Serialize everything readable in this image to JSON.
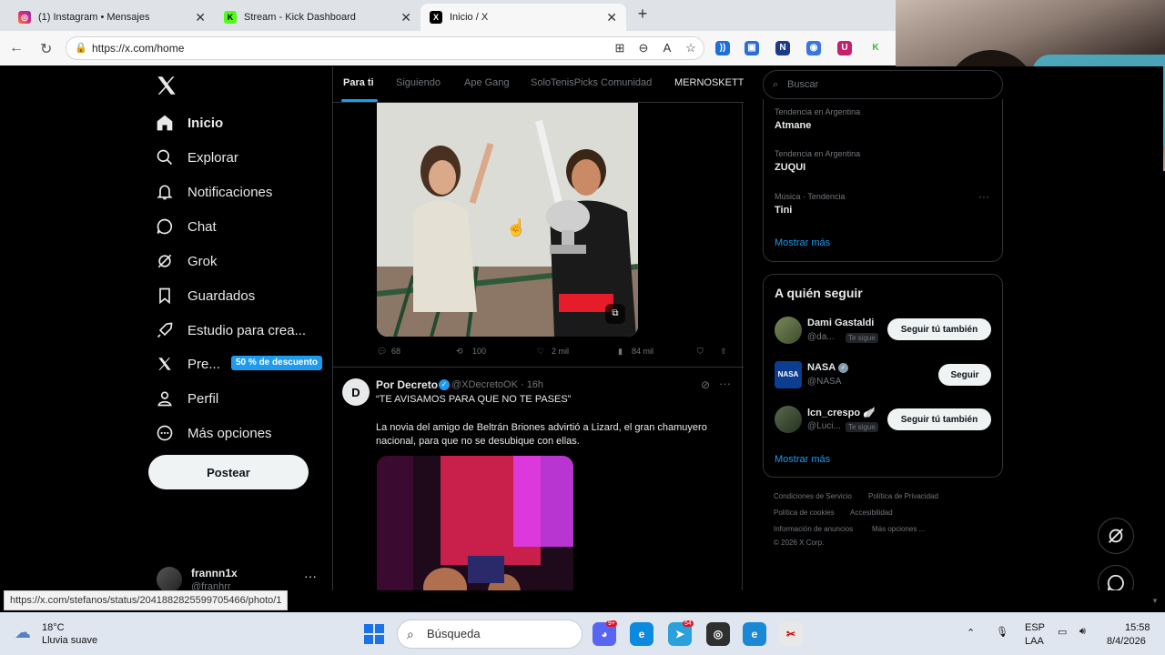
{
  "browser": {
    "tabs": [
      {
        "title": "(1) Instagram • Mensajes",
        "icon": "instagram-icon",
        "active": false
      },
      {
        "title": "Stream - Kick Dashboard",
        "icon": "kick-icon",
        "active": false
      },
      {
        "title": "Inicio / X",
        "icon": "x-icon",
        "active": true
      }
    ],
    "url": "https://x.com/home",
    "status_url": "https://x.com/stefanos/status/2041882825599705466/photo/1"
  },
  "nav": {
    "items": [
      {
        "label": "Inicio",
        "icon": "home-icon"
      },
      {
        "label": "Explorar",
        "icon": "search-icon"
      },
      {
        "label": "Notificaciones",
        "icon": "bell-icon"
      },
      {
        "label": "Chat",
        "icon": "chat-icon"
      },
      {
        "label": "Grok",
        "icon": "grok-icon"
      },
      {
        "label": "Guardados",
        "icon": "bookmark-icon"
      },
      {
        "label": "Estudio para crea...",
        "icon": "rocket-icon"
      },
      {
        "label": "Pre...",
        "icon": "x-icon"
      },
      {
        "label": "Perfil",
        "icon": "person-icon"
      },
      {
        "label": "Más opciones",
        "icon": "more-circle-icon"
      }
    ],
    "promo_badge": "50 % de descuento",
    "post_button": "Postear",
    "account": {
      "name": "frannn1x",
      "handle": "@franhrr"
    }
  },
  "feed": {
    "tabs": [
      "Para ti",
      "Siguiendo",
      "Ape Gang",
      "SoloTenisPicks Comunidad",
      "MERNOSKETTI"
    ],
    "tweet1_actions": {
      "replies": "68",
      "reposts": "100",
      "likes": "2 mil",
      "views": "84 mil"
    },
    "tweet2": {
      "name": "Por Decreto",
      "handle": "@XDecretoOK · 16h",
      "headline": "“TE AVISAMOS PARA QUE NO TE PASES”",
      "body": "La novia del amigo de Beltrán Briones advirtió a Lizard, el gran chamuyero nacional, para que no se desubique con ellas."
    }
  },
  "sidebar": {
    "search_placeholder": "Buscar",
    "trends": [
      {
        "meta": "Tendencia en Argentina",
        "name": "Atmane"
      },
      {
        "meta": "Tendencia en Argentina",
        "name": "ZUQUI"
      },
      {
        "meta": "Música · Tendencia",
        "name": "Tini"
      }
    ],
    "trends_more": "Mostrar más",
    "who_to_follow": {
      "title": "A quién seguir",
      "users": [
        {
          "name": "Dami Gastaldi",
          "handle": "@da...",
          "badge": "Te sigue",
          "button": "Seguir tú también"
        },
        {
          "name": "NASA",
          "handle": "@NASA",
          "badge": "",
          "button": "Seguir"
        },
        {
          "name": "lcn_crespo 🪽",
          "handle": "@Luci...",
          "badge": "Te sigue",
          "button": "Seguir tú también"
        }
      ],
      "more": "Mostrar más"
    },
    "footer": [
      "Condiciones de Servicio",
      "Política de Privacidad",
      "Política de cookies",
      "Accesibilidad",
      "Información de anuncios",
      "Más opciones ...",
      "© 2026 X Corp."
    ]
  },
  "taskbar": {
    "weather_temp": "18°C",
    "weather_desc": "Lluvia suave",
    "search_placeholder": "Búsqueda",
    "lang": "ESP",
    "lang2": "LAA",
    "time": "15:58",
    "date": "8/4/2026",
    "discord_badge": "9+",
    "telegram_badge": "54"
  },
  "colors": {
    "accent": "#1d9bf0",
    "background": "#000000",
    "text": "#e7e9ea",
    "muted": "#71767b"
  }
}
